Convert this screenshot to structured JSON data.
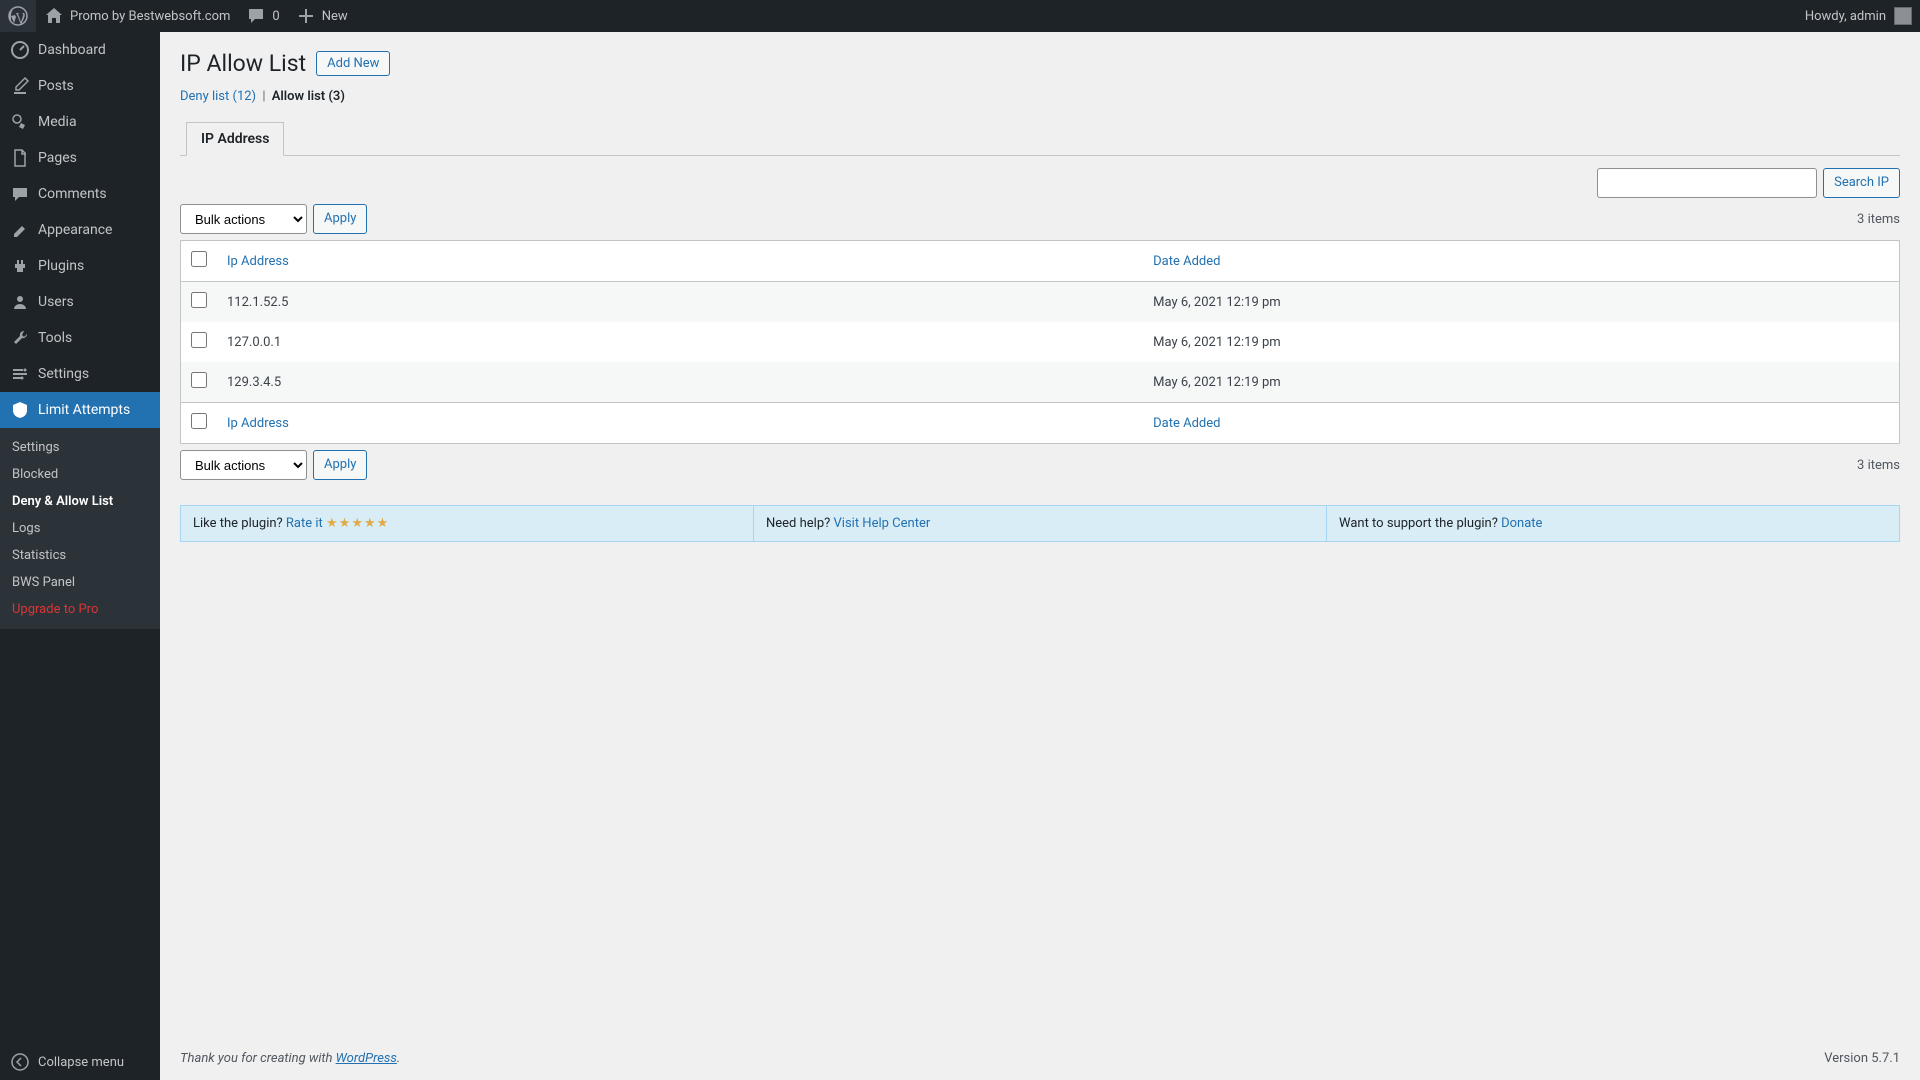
{
  "adminbar": {
    "site_name": "Promo by Bestwebsoft.com",
    "comments_count": "0",
    "new_label": "New",
    "howdy": "Howdy, admin"
  },
  "sidebar": {
    "items": [
      {
        "label": "Dashboard"
      },
      {
        "label": "Posts"
      },
      {
        "label": "Media"
      },
      {
        "label": "Pages"
      },
      {
        "label": "Comments"
      },
      {
        "label": "Appearance"
      },
      {
        "label": "Plugins"
      },
      {
        "label": "Users"
      },
      {
        "label": "Tools"
      },
      {
        "label": "Settings"
      },
      {
        "label": "Limit Attempts"
      }
    ],
    "submenu": [
      {
        "label": "Settings"
      },
      {
        "label": "Blocked"
      },
      {
        "label": "Deny & Allow List"
      },
      {
        "label": "Logs"
      },
      {
        "label": "Statistics"
      },
      {
        "label": "BWS Panel"
      },
      {
        "label": "Upgrade to Pro"
      }
    ],
    "collapse": "Collapse menu"
  },
  "page": {
    "title": "IP Allow List",
    "add_new": "Add New",
    "subsubsub": {
      "deny": "Deny list (12)",
      "sep": "|",
      "allow": "Allow list (3)"
    },
    "tab": "IP Address",
    "search_button": "Search IP",
    "bulk_actions": "Bulk actions",
    "apply": "Apply",
    "items_count": "3 items",
    "columns": {
      "ip": "Ip Address",
      "date": "Date Added"
    },
    "rows": [
      {
        "ip": "112.1.52.5",
        "date": "May 6, 2021 12:19 pm"
      },
      {
        "ip": "127.0.0.1",
        "date": "May 6, 2021 12:19 pm"
      },
      {
        "ip": "129.3.4.5",
        "date": "May 6, 2021 12:19 pm"
      }
    ],
    "promo": {
      "like": "Like the plugin? ",
      "rate": "Rate it",
      "help": "Need help? ",
      "help_link": "Visit Help Center",
      "support": "Want to support the plugin? ",
      "donate": "Donate"
    }
  },
  "footer": {
    "thank": "Thank you for creating with ",
    "wp": "WordPress",
    "period": ".",
    "version": "Version 5.7.1"
  }
}
